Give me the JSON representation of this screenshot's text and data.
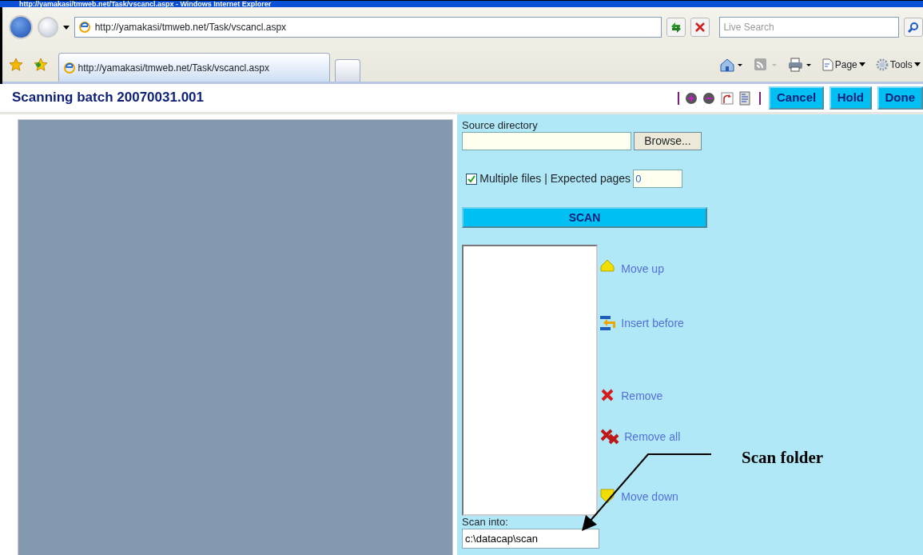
{
  "window": {
    "title": "http://yamakasi/tmweb.net/Task/vscancl.aspx - Windows Internet Explorer"
  },
  "address_bar": {
    "url": "http://yamakasi/tmweb.net/Task/vscancl.aspx"
  },
  "search": {
    "placeholder": "Live Search"
  },
  "tab": {
    "title": "http://yamakasi/tmweb.net/Task/vscancl.aspx"
  },
  "command_bar": [
    {
      "kind": "page",
      "label": "Page"
    },
    {
      "kind": "tools",
      "label": "Tools"
    }
  ],
  "header": {
    "title": "Scanning batch 20070031.001",
    "buttons": [
      "Cancel",
      "Hold",
      "Done"
    ]
  },
  "form": {
    "source_label": "Source directory",
    "browse_button": "Browse...",
    "multiple_files": {
      "checked": true,
      "label": "Multiple files | Expected pages"
    },
    "expected_pages": "0",
    "scan_button": "SCAN",
    "actions": [
      {
        "kind": "up",
        "label": "Move up"
      },
      {
        "kind": "insert",
        "label": "Insert before"
      },
      {
        "kind": "remove",
        "label": "Remove"
      },
      {
        "kind": "remove_all",
        "label": "Remove all"
      },
      {
        "kind": "down",
        "label": "Move down"
      }
    ],
    "scan_into_label": "Scan into:",
    "scan_into_value": "c:\\datacap\\scan"
  },
  "annotation": {
    "text": "Scan folder"
  }
}
